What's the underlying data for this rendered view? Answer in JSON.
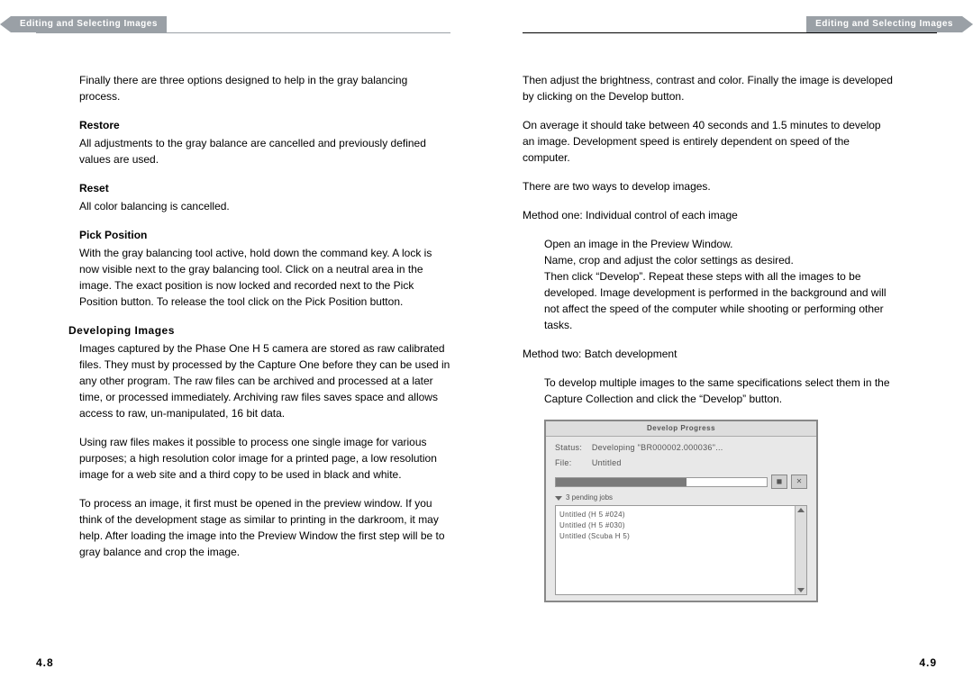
{
  "header": {
    "section_title": "Editing and Selecting Images"
  },
  "left": {
    "intro": "Finally there are three options designed to help in the gray balancing process.",
    "restore": {
      "title": "Restore",
      "body": "All adjustments to the gray balance are cancelled and previously defined values are used."
    },
    "reset": {
      "title": "Reset",
      "body": "All color balancing is cancelled."
    },
    "pick": {
      "title": "Pick Position",
      "body": "With the gray balancing tool active, hold down the command key. A lock is now visible next to the gray balancing tool. Click on a neutral area in the image. The exact position is now locked and recorded next to the Pick Position button. To release the tool click on the Pick Position button."
    },
    "developing": {
      "title": "Developing Images",
      "p1": "Images captured by the Phase One H 5 camera are stored as raw calibrated files. They must by processed by the Capture One before they can be used in any other program. The raw files can be archived and processed at a later time, or processed immediately. Archiving raw files saves space and allows access to raw, un-manipulated, 16 bit data.",
      "p2": "Using raw files makes it possible to process one single image for various purposes; a high resolution color image for a printed page, a low resolution image for a web site and a third copy to be used in black and white.",
      "p3": "To process an image, it first must be opened in the preview window. If you think of the development stage as similar to printing in the darkroom, it may help. After loading the image into the Preview Window the first step will be to gray balance and crop the image."
    },
    "page_num": "4.8"
  },
  "right": {
    "p1": "Then adjust the brightness, contrast and color. Finally the image is developed by clicking on the Develop button.",
    "p2": "On average it should take between 40 seconds and 1.5 minutes to develop an image. Development speed is entirely dependent on speed of the computer.",
    "p3": "There are two ways to develop images.",
    "m1_title": "Method one: Individual control of each image",
    "m1_body": "Open an image in the Preview Window.\nName, crop and adjust the color settings as desired.\nThen click “Develop”. Repeat these steps with all the images to be developed. Image development is performed in the background and will not affect the speed of the computer while shooting or performing other tasks.",
    "m2_title": "Method two: Batch development",
    "m2_body": "To develop multiple images to the same specifications select them in the Capture Collection and click the “Develop” button.",
    "dialog": {
      "title": "Develop Progress",
      "status_label": "Status:",
      "status_value": "Developing \"BR000002.000036\"...",
      "file_label": "File:",
      "file_value": "Untitled",
      "pending": "3 pending jobs",
      "jobs": {
        "j0": "Untitled (H 5 #024)",
        "j1": "Untitled (H 5 #030)",
        "j2": "Untitled (Scuba H 5)"
      }
    },
    "page_num": "4.9"
  }
}
